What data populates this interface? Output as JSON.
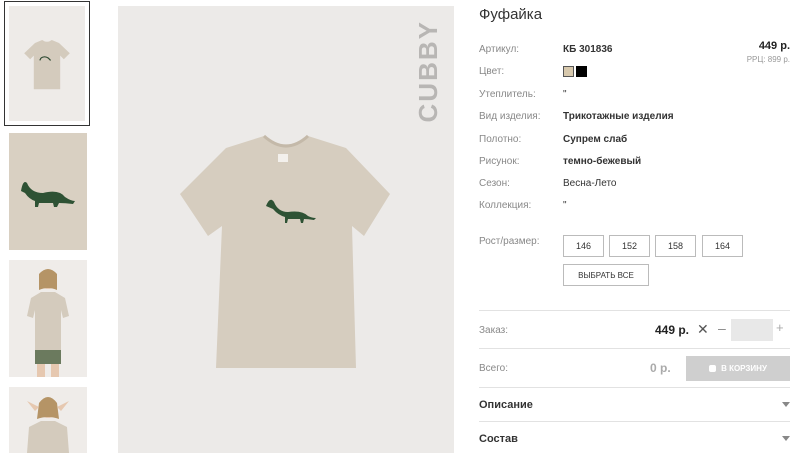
{
  "product": {
    "title": "Фуфайка",
    "price": "449 р.",
    "rrp": "РРЦ: 899 р.",
    "brand": "CUBBY"
  },
  "attributes": [
    {
      "label": "Артикул:",
      "value": "КБ 301836"
    },
    {
      "label": "Цвет:",
      "value": ""
    },
    {
      "label": "Утеплитель:",
      "value": "\""
    },
    {
      "label": "Вид изделия:",
      "value": "Трикотажные изделия"
    },
    {
      "label": "Полотно:",
      "value": "Супрем слаб"
    },
    {
      "label": "Рисунок:",
      "value": "темно-бежевый"
    },
    {
      "label": "Сезон:",
      "value": "Весна-Лето"
    },
    {
      "label": "Коллекция:",
      "value": "\""
    }
  ],
  "colors": [
    "#d8c9ad",
    "#000000"
  ],
  "sizes": {
    "label": "Рост/размер:",
    "options": [
      "146",
      "152",
      "158",
      "164"
    ],
    "select_all": "ВЫБРАТЬ ВСЕ"
  },
  "order": {
    "label": "Заказ:",
    "price": "449 р.",
    "times": "✕",
    "minus": "–",
    "plus": "+",
    "quantity": ""
  },
  "total": {
    "label": "Всего:",
    "value": "0 р.",
    "cart_button": "В КОРЗИНУ"
  },
  "accordion": [
    {
      "title": "Описание"
    },
    {
      "title": "Состав"
    }
  ]
}
